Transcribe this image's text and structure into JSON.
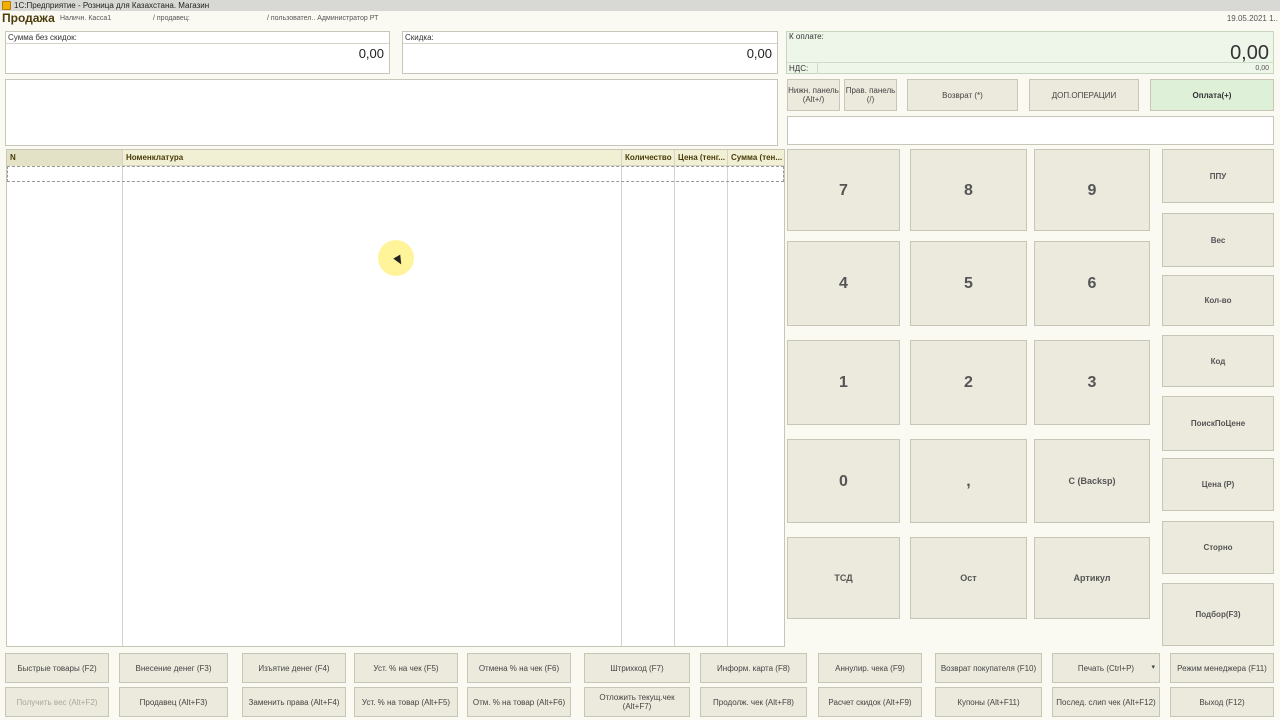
{
  "window": {
    "title": "1С:Предприятие - Розница для Казахстана. Магазин"
  },
  "header": {
    "title": "Продажа",
    "cashbox": "Наличн. Касса1",
    "seller": "/ продавец:",
    "user": "/ пользовател.. Администратор РТ",
    "date": "19.05.2021 1.."
  },
  "totals": {
    "sum_label": "Сумма без скидок:",
    "sum_value": "0,00",
    "discount_label": "Скидка:",
    "discount_value": "0,00",
    "pay_label": "К оплате:",
    "pay_value": "0,00",
    "vat_label": "НДС:",
    "vat_value": "0,00"
  },
  "top_buttons": {
    "lower_panel": "Нижн. панель (Alt+/)",
    "right_panel": "Прав. панель (/)",
    "return": "Возврат (*)",
    "extra_ops": "ДОП.ОПЕРАЦИИ",
    "payment": "Оплата(+)"
  },
  "table": {
    "columns": [
      "N",
      "Номенклатура",
      "Количество",
      "Цена (тенг...",
      "Сумма (тен..."
    ]
  },
  "keypad": {
    "k7": "7",
    "k8": "8",
    "k9": "9",
    "k4": "4",
    "k5": "5",
    "k6": "6",
    "k1": "1",
    "k2": "2",
    "k3": "3",
    "k0": "0",
    "comma": ",",
    "backspace": "С (Backsp)",
    "tsd": "ТСД",
    "ost": "Ост",
    "article": "Артикул"
  },
  "side_buttons": [
    "ППУ",
    "Вес",
    "Кол-во",
    "Код",
    "ПоискПоЦене",
    "Цена (Р)",
    "Сторно",
    "Подбор(F3)"
  ],
  "bottom_row1": [
    "Быстрые товары (F2)",
    "Внесение денег (F3)",
    "Изъятие денег (F4)",
    "Уст. % на чек (F5)",
    "Отмена % на чек (F6)",
    "Штрихкод (F7)",
    "Информ. карта (F8)",
    "Аннулир. чека (F9)",
    "Возврат покупателя (F10)",
    "Печать (Ctrl+P)",
    "Режим менеджера (F11)"
  ],
  "bottom_row2": [
    "Получить вес (Alt+F2)",
    "Продавец (Alt+F3)",
    "Заменить права (Alt+F4)",
    "Уст. % на товар (Alt+F5)",
    "Отм. % на товар (Alt+F6)",
    "Отложить текущ.чек (Alt+F7)",
    "Продолж. чек (Alt+F8)",
    "Расчет скидок (Alt+F9)",
    "Купоны (Alt+F11)",
    "Послед. слип чек (Alt+F12)",
    "Выход (F12)"
  ],
  "dropdown_glyph": "▾"
}
